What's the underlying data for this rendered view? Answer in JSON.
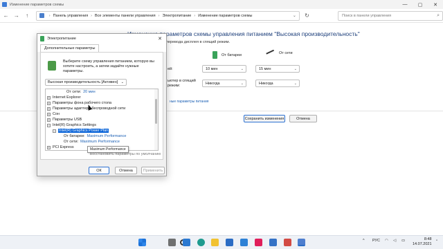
{
  "window": {
    "title": "Изменение параметров схемы",
    "controls": [
      "—",
      "▢",
      "✕"
    ]
  },
  "nav": {
    "back": "←",
    "forward": "→",
    "up": "↑",
    "breadcrumb": [
      "Панель управления",
      "Все элементы панели управления",
      "Электропитание",
      "Изменение параметров схемы"
    ],
    "breadcrumb_sep": "›",
    "refresh": "↻",
    "search_placeholder": "Поиск в панели управления"
  },
  "main": {
    "heading": "Изменение параметров схемы управления питанием \"Высокая производительность\"",
    "sub": "перевода дисплея в спящий режим.",
    "col_battery": "От батареи",
    "col_ac": "От сети",
    "row1_label": "ей:",
    "row2_label": "ьютер в спящий",
    "row2_label_b": "режим:",
    "display_battery": "10 мин",
    "display_ac": "15 мин",
    "sleep_battery": "Никогда",
    "sleep_ac": "Никогда",
    "advanced_link": "ные параметры питания",
    "save_label": "Сохранить изменения",
    "cancel_label": "Отмена"
  },
  "dialog": {
    "title": "Электропитание",
    "close": "✕",
    "tab": "Дополнительные параметры",
    "description": "Выберите схему управления питанием, которую вы хотите настроить, а затем задайте нужные параметры.",
    "plan_select": "Высокая производительность [Активен]",
    "tree": [
      {
        "label": "От сети:",
        "value": "20 мин",
        "level": 2,
        "expander": ""
      },
      {
        "label": "Internet Explorer",
        "value": "",
        "level": 0,
        "expander": "+"
      },
      {
        "label": "Параметры фона рабочего стола",
        "value": "",
        "level": 0,
        "expander": "+"
      },
      {
        "label": "Параметры адаптера беспроводной сети",
        "value": "",
        "level": 0,
        "expander": "+"
      },
      {
        "label": "Сон",
        "value": "",
        "level": 0,
        "expander": "+"
      },
      {
        "label": "Параметры USB",
        "value": "",
        "level": 0,
        "expander": "+"
      },
      {
        "label": "Intel(R) Graphics Settings",
        "value": "",
        "level": 0,
        "expander": "−"
      },
      {
        "label": "Intel(R) Graphics Power Plan",
        "value": "",
        "level": 1,
        "expander": "−",
        "selected": true
      },
      {
        "label": "От батареи:",
        "value": "Maximum Performance",
        "level": 2,
        "expander": ""
      },
      {
        "label": "От сети:",
        "value": "Maximum Performance",
        "level": 2,
        "expander": ""
      },
      {
        "label": "PCI Express",
        "value": "",
        "level": 0,
        "expander": "+"
      }
    ],
    "tooltip": "Maximum Performance",
    "restore_label": "Восстановить параметры по умолчанию",
    "ok_label": "ОК",
    "cancel_label": "Отмена",
    "apply_label": "Применить"
  },
  "taskbar": {
    "lang": "РУС",
    "time": "8:48",
    "date": "14.07.2021",
    "tray_up": "^"
  },
  "colors": {
    "accent": "#0a64d8",
    "link": "#1a5fb4",
    "heading": "#1c3e7a",
    "taskbar_bg": "#eef1f6"
  }
}
